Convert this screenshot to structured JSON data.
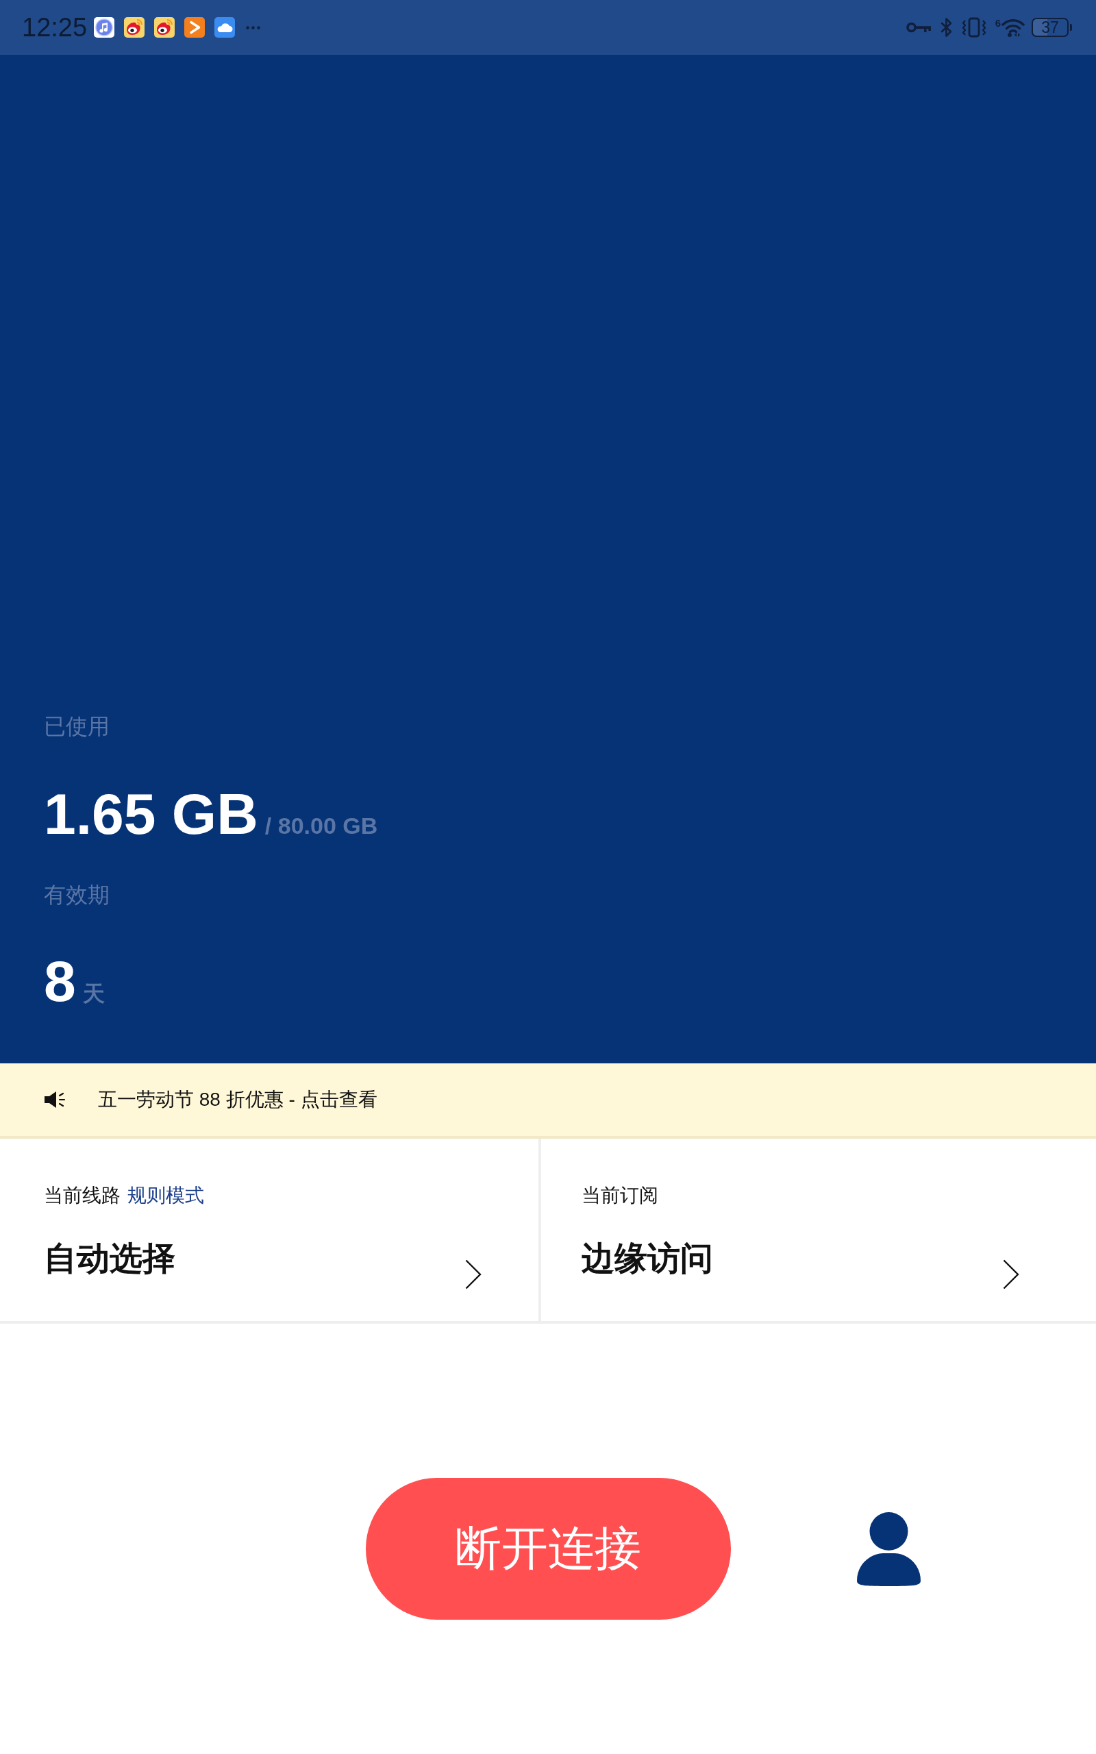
{
  "status_bar": {
    "time": "12:25",
    "wifi_label": "6",
    "battery": "37"
  },
  "usage": {
    "used_label": "已使用",
    "used": "1.65 GB",
    "quota": "/ 80.00 GB",
    "validity_label": "有效期",
    "days": "8",
    "days_unit": "天"
  },
  "notice": {
    "text": "五一劳动节 88 折优惠 - 点击查看"
  },
  "cards": [
    {
      "label": "当前线路",
      "tag": "规则模式",
      "value": "自动选择"
    },
    {
      "label": "当前订阅",
      "value": "边缘访问"
    }
  ],
  "actions": {
    "disconnect_button": "断开连接"
  }
}
